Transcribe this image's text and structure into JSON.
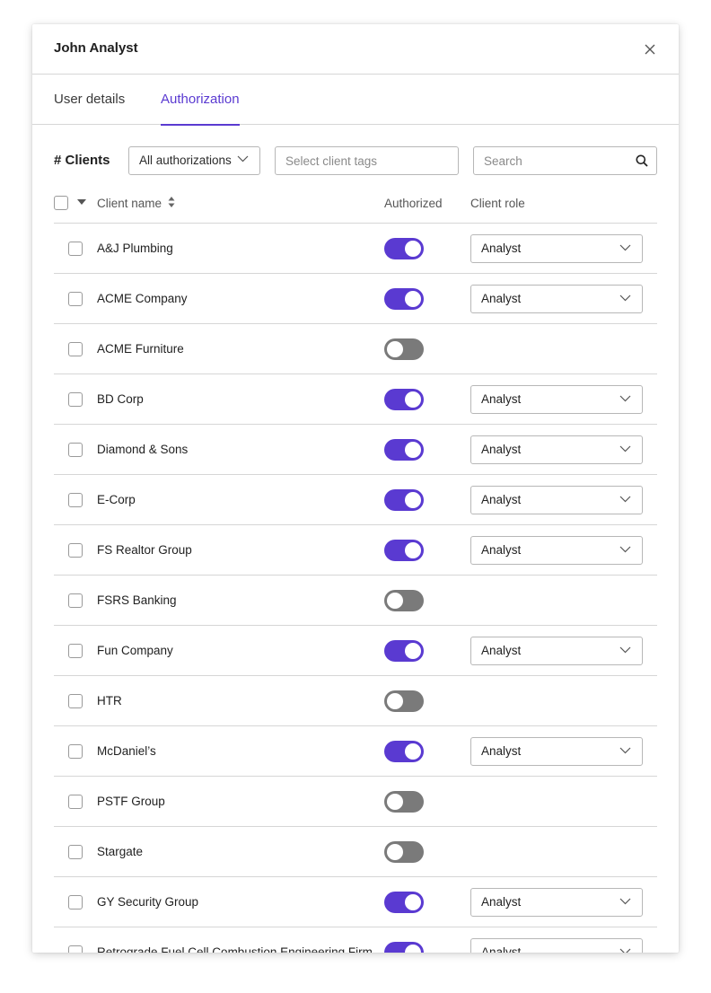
{
  "dialog": {
    "title": "John Analyst",
    "close_icon": "close-icon"
  },
  "tabs": [
    {
      "label": "User details",
      "active": false
    },
    {
      "label": "Authorization",
      "active": true
    }
  ],
  "toolbar": {
    "clients_label": "# Clients",
    "authorization_filter": "All authorizations",
    "tags_placeholder": "Select client tags",
    "search_placeholder": "Search"
  },
  "table": {
    "columns": {
      "name": "Client name",
      "authorized": "Authorized",
      "role": "Client role"
    },
    "rows": [
      {
        "name": "A&J Plumbing",
        "authorized": true,
        "role": "Analyst"
      },
      {
        "name": "ACME Company",
        "authorized": true,
        "role": "Analyst"
      },
      {
        "name": "ACME Furniture",
        "authorized": false,
        "role": ""
      },
      {
        "name": "BD Corp",
        "authorized": true,
        "role": "Analyst"
      },
      {
        "name": "Diamond & Sons",
        "authorized": true,
        "role": "Analyst"
      },
      {
        "name": "E-Corp",
        "authorized": true,
        "role": "Analyst"
      },
      {
        "name": "FS Realtor Group",
        "authorized": true,
        "role": "Analyst"
      },
      {
        "name": "FSRS Banking",
        "authorized": false,
        "role": ""
      },
      {
        "name": "Fun Company",
        "authorized": true,
        "role": "Analyst"
      },
      {
        "name": "HTR",
        "authorized": false,
        "role": ""
      },
      {
        "name": "McDaniel’s",
        "authorized": true,
        "role": "Analyst"
      },
      {
        "name": "PSTF Group",
        "authorized": false,
        "role": ""
      },
      {
        "name": "Stargate",
        "authorized": false,
        "role": ""
      },
      {
        "name": "GY Security Group",
        "authorized": true,
        "role": "Analyst"
      },
      {
        "name": "Retrograde Fuel Cell Combustion Engineering Firm",
        "authorized": true,
        "role": "Analyst"
      }
    ]
  },
  "colors": {
    "accent": "#5a3ad1",
    "toggle_off": "#7a7a7a",
    "border": "#b7b7b7",
    "divider": "#d6d6d6"
  }
}
